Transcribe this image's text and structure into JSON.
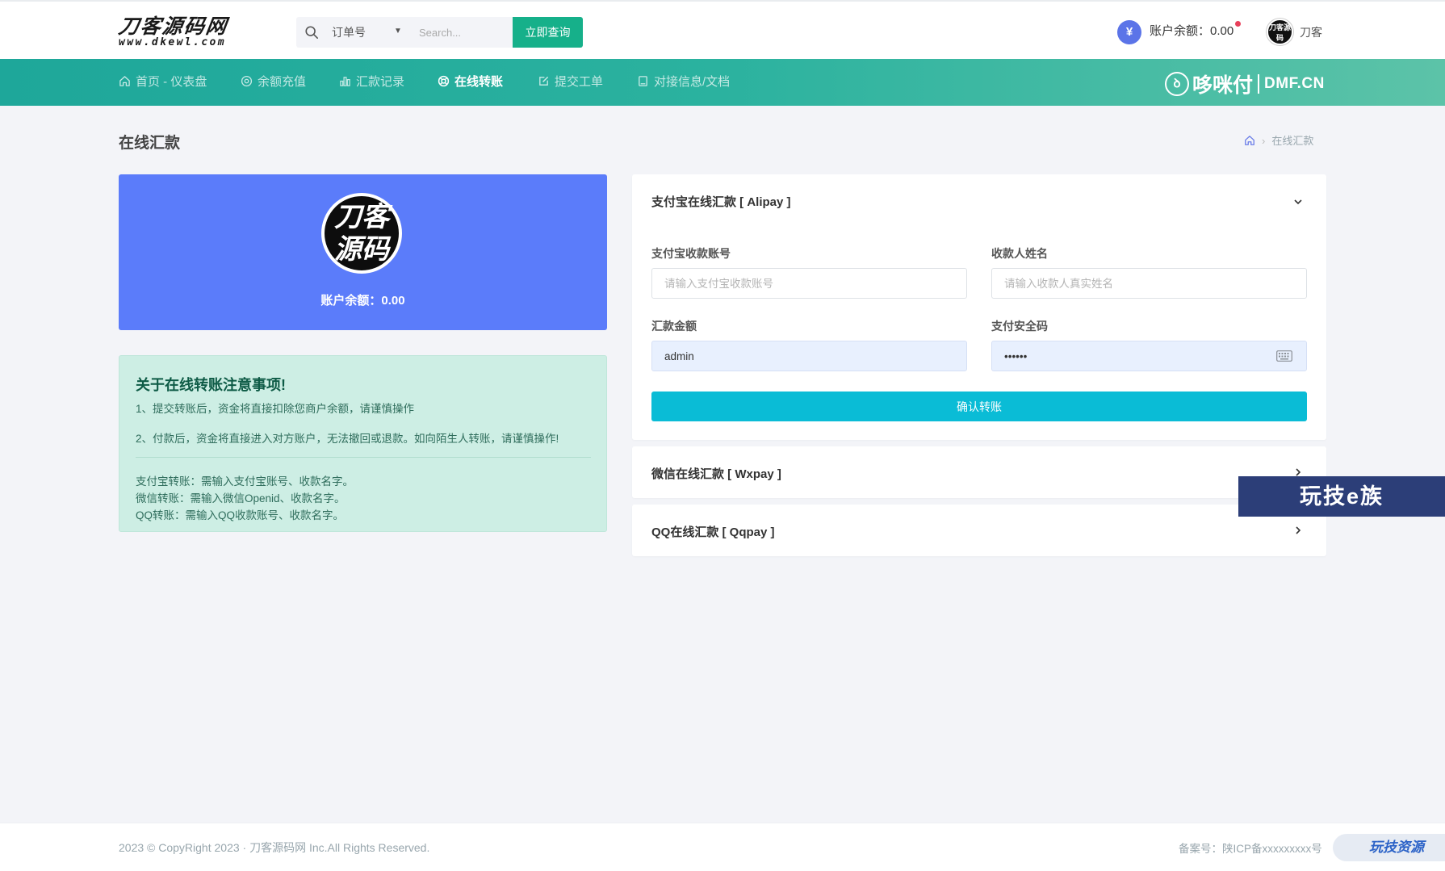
{
  "header": {
    "logo_main": "刀客源码网",
    "logo_sub": "www.dkewl.com",
    "search": {
      "select_value": "订单号",
      "placeholder": "Search...",
      "button_label": "立即查询"
    },
    "balance_symbol": "¥",
    "balance_label": "账户余额：0.00",
    "user_name": "刀客",
    "user_avatar_text": "刀客源码"
  },
  "nav": {
    "items": [
      {
        "label": "首页 - 仪表盘",
        "icon": "home-icon"
      },
      {
        "label": "余额充值",
        "icon": "circle-dot-icon"
      },
      {
        "label": "汇款记录",
        "icon": "bar-chart-icon"
      },
      {
        "label": "在线转账",
        "icon": "lifebuoy-icon"
      },
      {
        "label": "提交工单",
        "icon": "edit-icon"
      },
      {
        "label": "对接信息/文档",
        "icon": "document-icon"
      }
    ],
    "active_index": 3,
    "brand_name": "哆咪付",
    "brand_domain": "DMF.CN"
  },
  "page": {
    "title": "在线汇款",
    "breadcrumb": "在线汇款"
  },
  "profile": {
    "avatar_line1": "刀客",
    "avatar_line2": "源码",
    "balance_label": "账户余额：0.00"
  },
  "notice": {
    "title": "关于在线转账注意事项!",
    "line1": "1、提交转账后，资金将直接扣除您商户余额，请谨慎操作",
    "line2": "2、付款后，资金将直接进入对方账户，无法撤回或退款。如向陌生人转账，请谨慎操作!",
    "line3": "支付宝转账：需输入支付宝账号、收款名字。",
    "line4": "微信转账：需输入微信Openid、收款名字。",
    "line5": "QQ转账：需输入QQ收款账号、收款名字。"
  },
  "alipay": {
    "title": "支付宝在线汇款 [ Alipay ]",
    "account_label": "支付宝收款账号",
    "account_placeholder": "请输入支付宝收款账号",
    "name_label": "收款人姓名",
    "name_placeholder": "请输入收款人真实姓名",
    "amount_label": "汇款金额",
    "amount_value": "admin",
    "password_label": "支付安全码",
    "password_value": "••••••",
    "confirm_label": "确认转账"
  },
  "wxpay": {
    "title": "微信在线汇款 [ Wxpay ]"
  },
  "qqpay": {
    "title": "QQ在线汇款 [ Qqpay ]"
  },
  "watermark": "玩技e族",
  "footer": {
    "copyright": "2023 © CopyRight 2023 · 刀客源码网 Inc.All Rights Reserved.",
    "icp": "备案号：陕ICP备xxxxxxxxx号",
    "badge": "玩技资源"
  },
  "colors": {
    "nav_gradient_start": "#1ea79a",
    "nav_gradient_end": "#5cc3a8",
    "profile_card": "#5b7cfa",
    "notice_bg": "#cdeee4",
    "confirm_button": "#0abcd6",
    "search_button": "#16b08a"
  }
}
